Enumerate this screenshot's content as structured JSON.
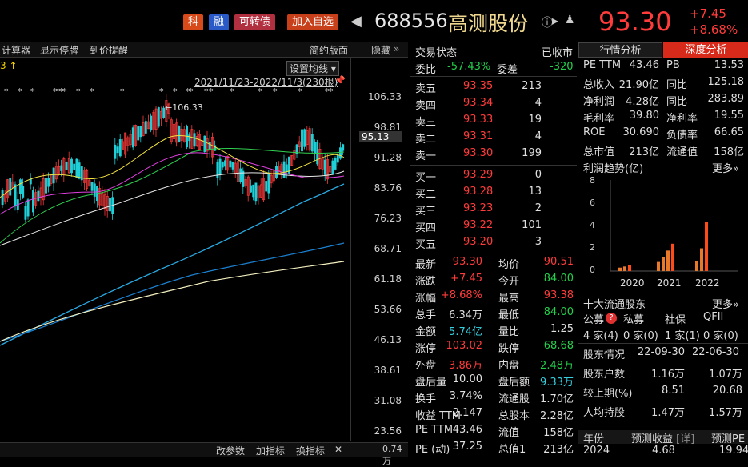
{
  "header": {
    "tags": [
      {
        "label": "科",
        "color": "#d84a1a"
      },
      {
        "label": "融",
        "color": "#2a5ac8"
      },
      {
        "label": "可转债",
        "color": "#b03040"
      },
      {
        "label": "加入自选",
        "color": "#c8401a"
      }
    ],
    "code": "688556",
    "name": "高测股份",
    "price": "93.30",
    "change": "+7.45",
    "change_pct": "+8.68%"
  },
  "toolbar": {
    "items": [
      "计算器",
      "显示停牌",
      "到价提醒"
    ],
    "right_items": [
      "简约版面",
      "隐藏"
    ],
    "ma_label": "设置均线",
    "date_range": "2021/11/23-2022/11/3(230根)",
    "left_marker": "3 ↑",
    "high_label": "106.33"
  },
  "axis_ticks": [
    "106.33",
    "98.81",
    "91.28",
    "83.76",
    "76.23",
    "68.71",
    "61.18",
    "53.66",
    "46.13",
    "38.61",
    "31.08",
    "23.56",
    "0.74万"
  ],
  "axis_current": "95.13",
  "bottombar": [
    "改参数",
    "加指标",
    "换指标"
  ],
  "mid": {
    "title": "交易状态",
    "status": "已收市",
    "webi_label": "委比",
    "webi": "-57.43%",
    "weicha_label": "委差",
    "weicha": "-320",
    "asks": [
      {
        "label": "卖五",
        "price": "93.35",
        "vol": "213"
      },
      {
        "label": "卖四",
        "price": "93.34",
        "vol": "4"
      },
      {
        "label": "卖三",
        "price": "93.33",
        "vol": "19"
      },
      {
        "label": "卖二",
        "price": "93.31",
        "vol": "4"
      },
      {
        "label": "卖一",
        "price": "93.30",
        "vol": "199"
      }
    ],
    "bids": [
      {
        "label": "买一",
        "price": "93.29",
        "vol": "0"
      },
      {
        "label": "买二",
        "price": "93.28",
        "vol": "13"
      },
      {
        "label": "买三",
        "price": "93.23",
        "vol": "2"
      },
      {
        "label": "买四",
        "price": "93.22",
        "vol": "101"
      },
      {
        "label": "买五",
        "price": "93.20",
        "vol": "3"
      }
    ],
    "stats": [
      {
        "l1": "最新",
        "v1": "93.30",
        "c1": "red",
        "l2": "均价",
        "v2": "90.51",
        "c2": "red"
      },
      {
        "l1": "涨跌",
        "v1": "+7.45",
        "c1": "red",
        "l2": "今开",
        "v2": "84.00",
        "c2": "green"
      },
      {
        "l1": "涨幅",
        "v1": "+8.68%",
        "c1": "red",
        "l2": "最高",
        "v2": "93.38",
        "c2": "red"
      },
      {
        "l1": "总手",
        "v1": "6.34万",
        "c1": "white",
        "l2": "最低",
        "v2": "84.00",
        "c2": "green"
      },
      {
        "l1": "金额",
        "v1": "5.74亿",
        "c1": "cyan",
        "l2": "量比",
        "v2": "1.25",
        "c2": "white"
      },
      {
        "l1": "涨停",
        "v1": "103.02",
        "c1": "red",
        "l2": "跌停",
        "v2": "68.68",
        "c2": "green"
      },
      {
        "l1": "外盘",
        "v1": "3.86万",
        "c1": "red",
        "l2": "内盘",
        "v2": "2.48万",
        "c2": "green"
      },
      {
        "l1": "盘后量",
        "v1": "10.00",
        "c1": "white",
        "l2": "盘后额",
        "v2": "9.33万",
        "c2": "cyan"
      },
      {
        "l1": "换手",
        "v1": "3.74%",
        "c1": "white",
        "l2": "流通股",
        "v2": "1.70亿",
        "c2": "white"
      },
      {
        "l1": "收益 TTM",
        "v1": "2.147",
        "c1": "white",
        "l2": "总股本",
        "v2": "2.28亿",
        "c2": "white"
      },
      {
        "l1": "PE TTM",
        "v1": "43.46",
        "c1": "white",
        "l2": "流值",
        "v2": "158亿",
        "c2": "white"
      },
      {
        "l1": "PE (动)",
        "v1": "37.25",
        "c1": "white",
        "l2": "总值1",
        "v2": "213亿",
        "c2": "white"
      }
    ]
  },
  "right": {
    "tabs": [
      "行情分析",
      "深度分析"
    ],
    "metrics": [
      {
        "l1": "PE TTM",
        "v1": "43.46",
        "l2": "PB",
        "v2": "13.53"
      },
      {
        "l1": "总收入",
        "v1": "21.90亿",
        "l2": "同比",
        "v2": "125.18"
      },
      {
        "l1": "净利润",
        "v1": "4.28亿",
        "l2": "同比",
        "v2": "283.89"
      },
      {
        "l1": "毛利率",
        "v1": "39.80",
        "l2": "净利率",
        "v2": "19.55"
      },
      {
        "l1": "ROE",
        "v1": "30.690",
        "l2": "负债率",
        "v2": "66.65"
      },
      {
        "l1": "总市值",
        "v1": "213亿",
        "l2": "流通值",
        "v2": "158亿"
      }
    ],
    "profit_title": "利润趋势(亿)",
    "more": "更多»",
    "profit_axis": [
      "8",
      "6",
      "4",
      "2",
      "0"
    ],
    "profit_years": [
      "2020",
      "2021",
      "2022"
    ],
    "holders_title": "十大流通股东",
    "holder_types": [
      "公募",
      "私募",
      "社保",
      "QFII"
    ],
    "holder_counts": [
      "4 家(4)",
      "0 家(0)",
      "1 家(1)",
      "0 家(0)"
    ],
    "sh_header": [
      "股东情况",
      "22-09-30",
      "22-06-30"
    ],
    "sh_rows": [
      {
        "label": "股东户数",
        "a": "1.16万",
        "b": "1.07万"
      },
      {
        "label": "较上期(%)",
        "a": "8.51",
        "b": "20.68"
      },
      {
        "label": "人均持股",
        "a": "1.47万",
        "b": "1.57万"
      }
    ],
    "forecast_header": [
      "年份",
      "预测收益",
      "[详]",
      "预测PE"
    ],
    "forecast_row": [
      "2024",
      "4.68",
      "19.94"
    ]
  },
  "chart_data": {
    "type": "candlestick",
    "date_range": "2021/11/23-2022/11/3",
    "bars": 230,
    "ylim": [
      23.56,
      106.33
    ],
    "last_close": 93.3,
    "high": 106.33,
    "profit_bars": {
      "years": [
        "2020",
        "2021",
        "2022"
      ],
      "values": [
        [
          0.3,
          0.4,
          0.5
        ],
        [
          0.8,
          1.2,
          1.8,
          2.4
        ],
        [
          0.9,
          2.0,
          4.3
        ]
      ],
      "ylim": [
        0,
        8
      ]
    }
  }
}
